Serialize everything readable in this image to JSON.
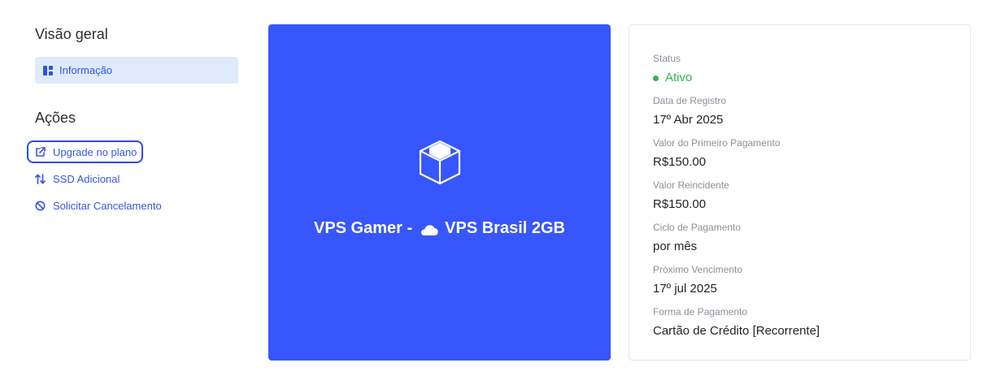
{
  "sidebar": {
    "overview_heading": "Visão geral",
    "info_item": "Informação",
    "actions_heading": "Ações",
    "actions": [
      {
        "label": "Upgrade no plano",
        "icon": "external-link-icon"
      },
      {
        "label": "SSD Adicional",
        "icon": "swap-vertical-icon"
      },
      {
        "label": "Solicitar Cancelamento",
        "icon": "ban-icon"
      }
    ]
  },
  "product": {
    "title_prefix": "VPS Gamer -",
    "title_suffix": "VPS Brasil 2GB",
    "icon": "cube-icon",
    "background": "#3756fb"
  },
  "details": {
    "status_label": "Status",
    "status_value": "Ativo",
    "status_color": "#2fb64f",
    "registration_label": "Data de Registro",
    "registration_value": "17º Abr 2025",
    "first_payment_label": "Valor do Primeiro Pagamento",
    "first_payment_value": "R$150.00",
    "recurring_label": "Valor Reincidente",
    "recurring_value": "R$150.00",
    "billing_cycle_label": "Ciclo de Pagamento",
    "billing_cycle_value": "por mês",
    "next_due_label": "Próximo Vencimento",
    "next_due_value": "17º jul 2025",
    "payment_method_label": "Forma de Pagamento",
    "payment_method_value": "Cartão de Crédito [Recorrente]"
  }
}
